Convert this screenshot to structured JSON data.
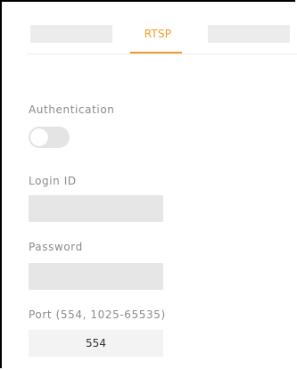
{
  "tabs": {
    "active_label": "RTSP"
  },
  "authentication": {
    "label": "Authentication",
    "enabled": false
  },
  "login": {
    "label": "Login ID",
    "value": ""
  },
  "password": {
    "label": "Password",
    "value": ""
  },
  "port": {
    "label": "Port (554, 1025-65535)",
    "value": "554"
  },
  "colors": {
    "accent": "#f39b2a",
    "label": "#8a8a8a",
    "field_bg": "#e6e6e6"
  }
}
